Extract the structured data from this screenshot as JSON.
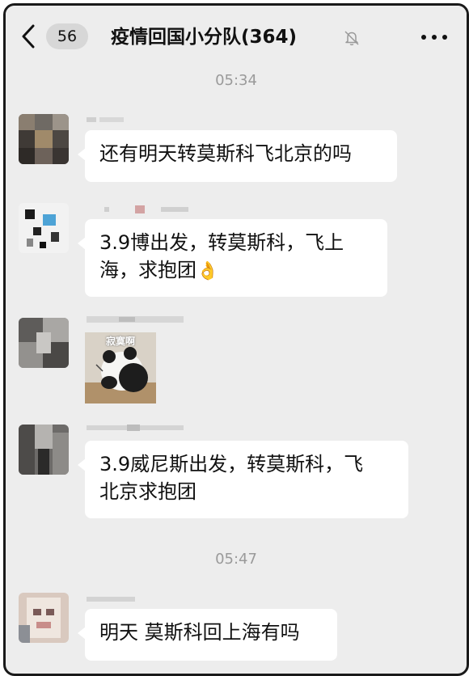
{
  "header": {
    "back_count": "56",
    "title": "疫情回国小分队(364)",
    "mute_icon": "bell-mute-icon",
    "more_icon": "more-dots-icon"
  },
  "messages": [
    {
      "type": "timestamp",
      "text": "05:34"
    },
    {
      "type": "text",
      "text": "还有明天转莫斯科飞北京的吗"
    },
    {
      "type": "text",
      "line1": "3.9博出发，转莫斯科，飞上",
      "line2": "海，求抱团",
      "emoji": "👌"
    },
    {
      "type": "sticker",
      "caption": "寂寞啊"
    },
    {
      "type": "text",
      "line1": "3.9威尼斯出发，转莫斯科，飞",
      "line2": "北京求抱团"
    },
    {
      "type": "timestamp",
      "text": "05:47"
    },
    {
      "type": "text",
      "text": "明天 莫斯科回上海有吗"
    }
  ],
  "colors": {
    "background": "#ededed",
    "bubble": "#ffffff",
    "timestamp": "#9a9a9a"
  }
}
